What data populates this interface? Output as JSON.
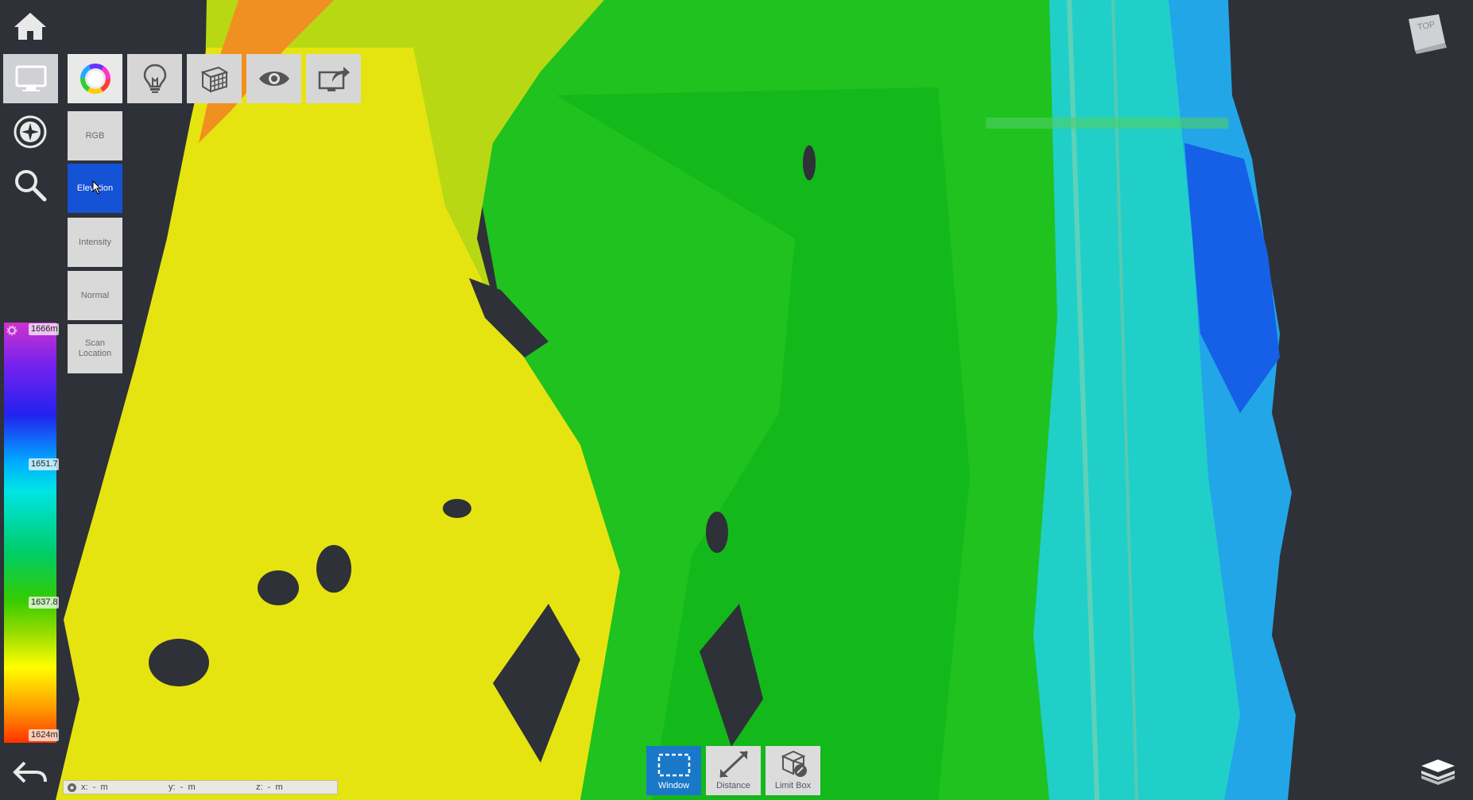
{
  "toolbar": {
    "tools": [
      "display-mode",
      "color-mode",
      "lighting",
      "clipping",
      "visibility",
      "export"
    ]
  },
  "color_modes": [
    {
      "label": "RGB"
    },
    {
      "label": "Elevation",
      "selected": true
    },
    {
      "label": "Intensity"
    },
    {
      "label": "Normal"
    },
    {
      "label": "Scan Location"
    }
  ],
  "color_scale": {
    "max": "1666m",
    "mid_high": "1651.7",
    "mid_low": "1637.8",
    "min": "1624m"
  },
  "measure_tools": {
    "window": "Window",
    "distance": "Distance",
    "limit_box": "Limit Box"
  },
  "coords": {
    "x": "x:  -  m",
    "y": "y:  -  m",
    "z": "z:  -  m"
  },
  "view_cube": {
    "label": "TOP"
  },
  "colors": {
    "accent": "#1452d6",
    "active_tool": "#1a78c9"
  }
}
